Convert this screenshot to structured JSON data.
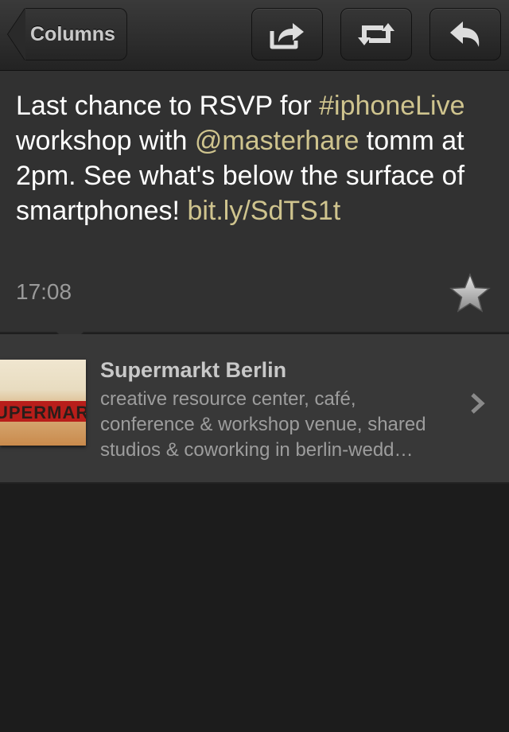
{
  "navbar": {
    "back_label": "Columns",
    "buttons": [
      {
        "icon": "share-icon"
      },
      {
        "icon": "retweet-icon"
      },
      {
        "icon": "reply-icon"
      }
    ]
  },
  "tweet": {
    "segments": [
      {
        "text": "Last chance to RSVP for ",
        "type": "text"
      },
      {
        "text": "#iphoneLive",
        "type": "hashtag"
      },
      {
        "text": " workshop with ",
        "type": "text"
      },
      {
        "text": "@masterhare",
        "type": "mention"
      },
      {
        "text": " tomm at 2pm. See what's below the surface of smartphones! ",
        "type": "text"
      },
      {
        "text": "bit.ly/SdTS1t",
        "type": "link"
      }
    ],
    "timestamp": "17:08",
    "favorite_icon": "star-icon"
  },
  "preview": {
    "thumbnail_text": "UPERMAR",
    "title": "Supermarkt Berlin",
    "description": "creative resource center, café,\nconference & workshop venue, shared\nstudios & coworking in berlin-wedd…",
    "chevron_icon": "chevron-right-icon"
  },
  "colors": {
    "highlight": "#cfc48e",
    "background": "#1c1c1c",
    "tweet_bg": "#313131",
    "card_bg": "#383838"
  }
}
